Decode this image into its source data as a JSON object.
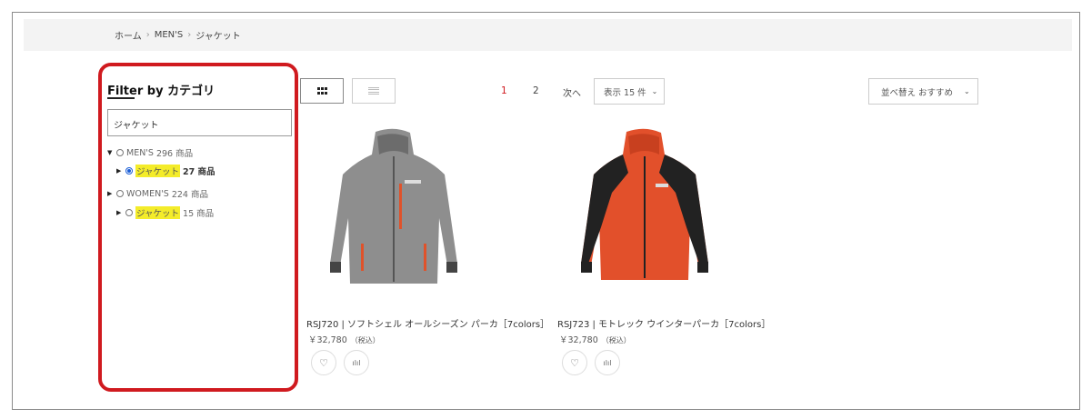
{
  "breadcrumb": {
    "home": "ホーム",
    "sep1": "›",
    "mens": "MEN'S",
    "sep2": "›",
    "current": "ジャケット"
  },
  "sidebar": {
    "title": "Filter by カテゴリ",
    "search_value": "ジャケット",
    "tree": [
      {
        "caret": "▼",
        "label": "MEN'S",
        "count": "296 商品",
        "checked": false
      },
      {
        "caret": "▶",
        "label": "ジャケット",
        "count": "27 商品",
        "checked": true
      },
      {
        "caret": "▶",
        "label": "WOMEN'S",
        "count": "224 商品",
        "checked": false
      },
      {
        "caret": "▶",
        "label": "ジャケット",
        "count": "15 商品",
        "checked": false
      }
    ]
  },
  "toolbar": {
    "view_grid_icon": "grid-icon",
    "view_list_icon": "list-icon",
    "pages": [
      "1",
      "2"
    ],
    "next_label": "次へ",
    "per_page_label": "表示 15 件",
    "sort_label": "並べ替え おすすめ",
    "chevron": "⌄"
  },
  "products": [
    {
      "name": "RSJ720 | ソフトシェル オールシーズン パーカ［7colors］",
      "price": "￥32,780",
      "tax": "（税込）",
      "color": "#8c8c8c",
      "accent": "#e0522a"
    },
    {
      "name": "RSJ723 | モトレック ウインターパーカ［7colors］",
      "price": "￥32,780",
      "tax": "（税込）",
      "color": "#e2502b",
      "accent": "#222222"
    }
  ],
  "icons": {
    "favorite": "♡",
    "compare": "ılıl"
  },
  "colors": {
    "highlight_border": "#d01a1f",
    "current_page": "#d01a1f",
    "search_highlight": "#f4ec2a"
  }
}
